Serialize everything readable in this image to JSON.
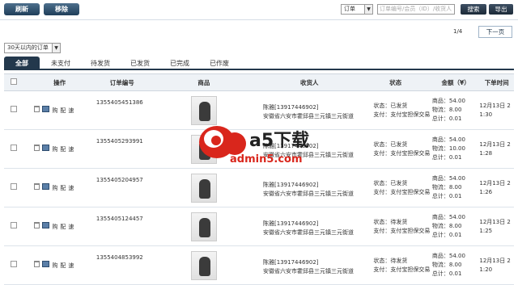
{
  "toolbar": {
    "refresh_label": "刷新",
    "move_label": "移除",
    "search_type": "订单",
    "search_placeholder": "订单编号/会员（ID）/收货人",
    "search_button": "搜索",
    "export_button": "导出"
  },
  "pager": {
    "page": "1/4",
    "next": "下一页"
  },
  "filter": {
    "period": "30天以内的订单"
  },
  "tabs": [
    "全部",
    "未支付",
    "待发货",
    "已发货",
    "已完成",
    "已作废"
  ],
  "table": {
    "headers": [
      "操作",
      "订单编号",
      "商品",
      "收货人",
      "状态",
      "金额（¥）",
      "下单时间"
    ],
    "op_labels": {
      "buy": "购",
      "dist": "配",
      "fast": "速"
    },
    "rows": [
      {
        "id": "1355405451386",
        "receiver": "陈雅[13917446902]",
        "addr": "安徽省六安市霍邱县三元镇三元街道",
        "state": "状态：已发货",
        "pay": "支付：支付宝担保交易",
        "goods": "商品：54.00",
        "ship": "物流：8.00",
        "total": "总计：0.01",
        "time": "12月13日 21:30"
      },
      {
        "id": "1355405293991",
        "receiver": "陈雅[13917446902]",
        "addr": "安徽省六安市霍邱县三元镇三元街道",
        "state": "状态：已发货",
        "pay": "支付：支付宝担保交易",
        "goods": "商品：54.00",
        "ship": "物流：10.00",
        "total": "总计：0.01",
        "time": "12月13日 21:28"
      },
      {
        "id": "1355405204957",
        "receiver": "陈雅[13917446902]",
        "addr": "安徽省六安市霍邱县三元镇三元街道",
        "state": "状态：已发货",
        "pay": "支付：支付宝担保交易",
        "goods": "商品：54.00",
        "ship": "物流：8.00",
        "total": "总计：0.01",
        "time": "12月13日 21:26"
      },
      {
        "id": "1355405124457",
        "receiver": "陈雅[13917446902]",
        "addr": "安徽省六安市霍邱县三元镇三元街道",
        "state": "状态：待发货",
        "pay": "支付：支付宝担保交易",
        "goods": "商品：54.00",
        "ship": "物流：8.00",
        "total": "总计：0.01",
        "time": "12月13日 21:25"
      },
      {
        "id": "1355404853992",
        "receiver": "陈雅[13917446902]",
        "addr": "安徽省六安市霍邱县三元镇三元街道",
        "state": "状态：待发货",
        "pay": "支付：支付宝担保交易",
        "goods": "商品：54.00",
        "ship": "物流：8.00",
        "total": "总计：0.01",
        "time": "12月13日 21:20"
      }
    ]
  },
  "watermark": {
    "brand": "a5下载",
    "site": "admin5.com"
  },
  "colors": {
    "tab_active": "#23384c",
    "button": "#2b4a68",
    "watermark_red": "#d9261c"
  }
}
